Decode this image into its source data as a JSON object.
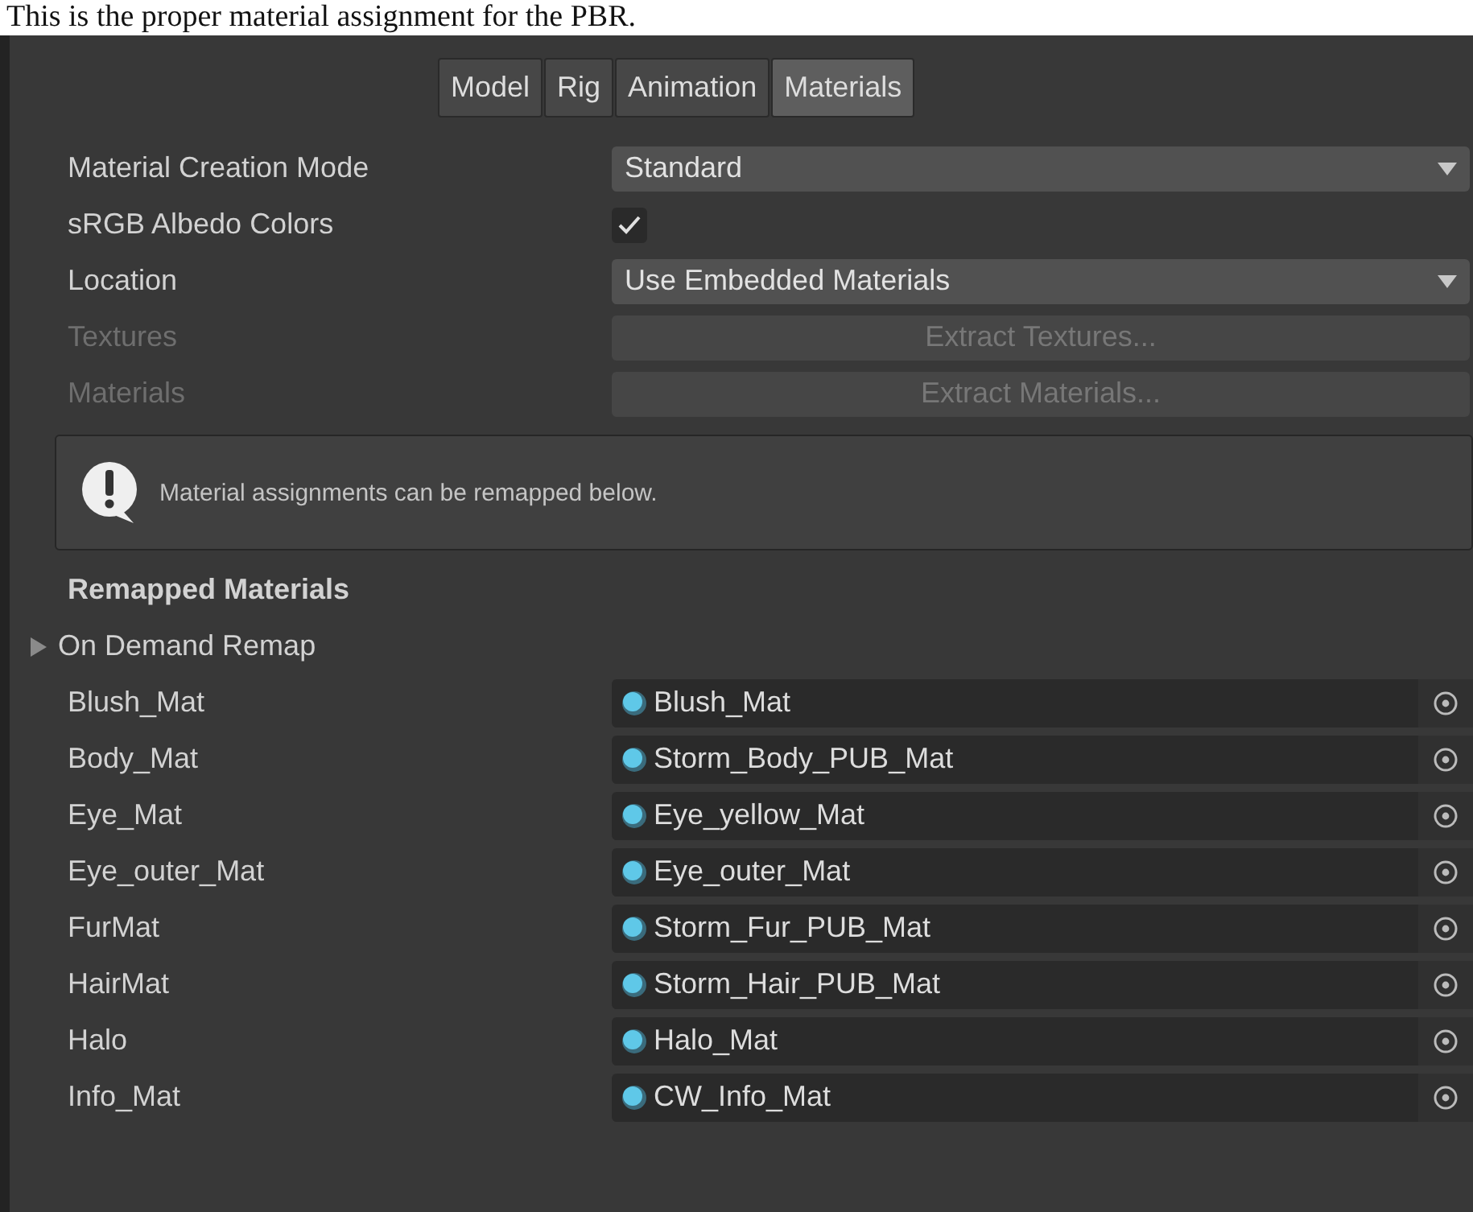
{
  "caption": "This is the proper material assignment for the PBR.",
  "tabs": [
    {
      "label": "Model",
      "selected": false
    },
    {
      "label": "Rig",
      "selected": false
    },
    {
      "label": "Animation",
      "selected": false
    },
    {
      "label": "Materials",
      "selected": true
    }
  ],
  "settings": [
    {
      "kind": "dropdown",
      "label": "Material Creation Mode",
      "value": "Standard",
      "disabled": false
    },
    {
      "kind": "checkbox",
      "label": "sRGB Albedo Colors",
      "checked": true,
      "disabled": false
    },
    {
      "kind": "dropdown",
      "label": "Location",
      "value": "Use Embedded Materials",
      "disabled": false
    },
    {
      "kind": "button",
      "label": "Textures",
      "value": "Extract Textures...",
      "disabled": true
    },
    {
      "kind": "button",
      "label": "Materials",
      "value": "Extract Materials...",
      "disabled": true
    }
  ],
  "help_box": {
    "message": "Material assignments can be remapped below."
  },
  "remapped": {
    "title": "Remapped Materials",
    "foldout": {
      "label": "On Demand Remap",
      "expanded": false
    },
    "rows": [
      {
        "label": "Blush_Mat",
        "value": "Blush_Mat"
      },
      {
        "label": "Body_Mat",
        "value": "Storm_Body_PUB_Mat"
      },
      {
        "label": "Eye_Mat",
        "value": "Eye_yellow_Mat"
      },
      {
        "label": "Eye_outer_Mat",
        "value": "Eye_outer_Mat"
      },
      {
        "label": "FurMat",
        "value": "Storm_Fur_PUB_Mat"
      },
      {
        "label": "HairMat",
        "value": "Storm_Hair_PUB_Mat"
      },
      {
        "label": "Halo",
        "value": "Halo_Mat"
      },
      {
        "label": "Info_Mat",
        "value": "CW_Info_Mat"
      }
    ]
  }
}
